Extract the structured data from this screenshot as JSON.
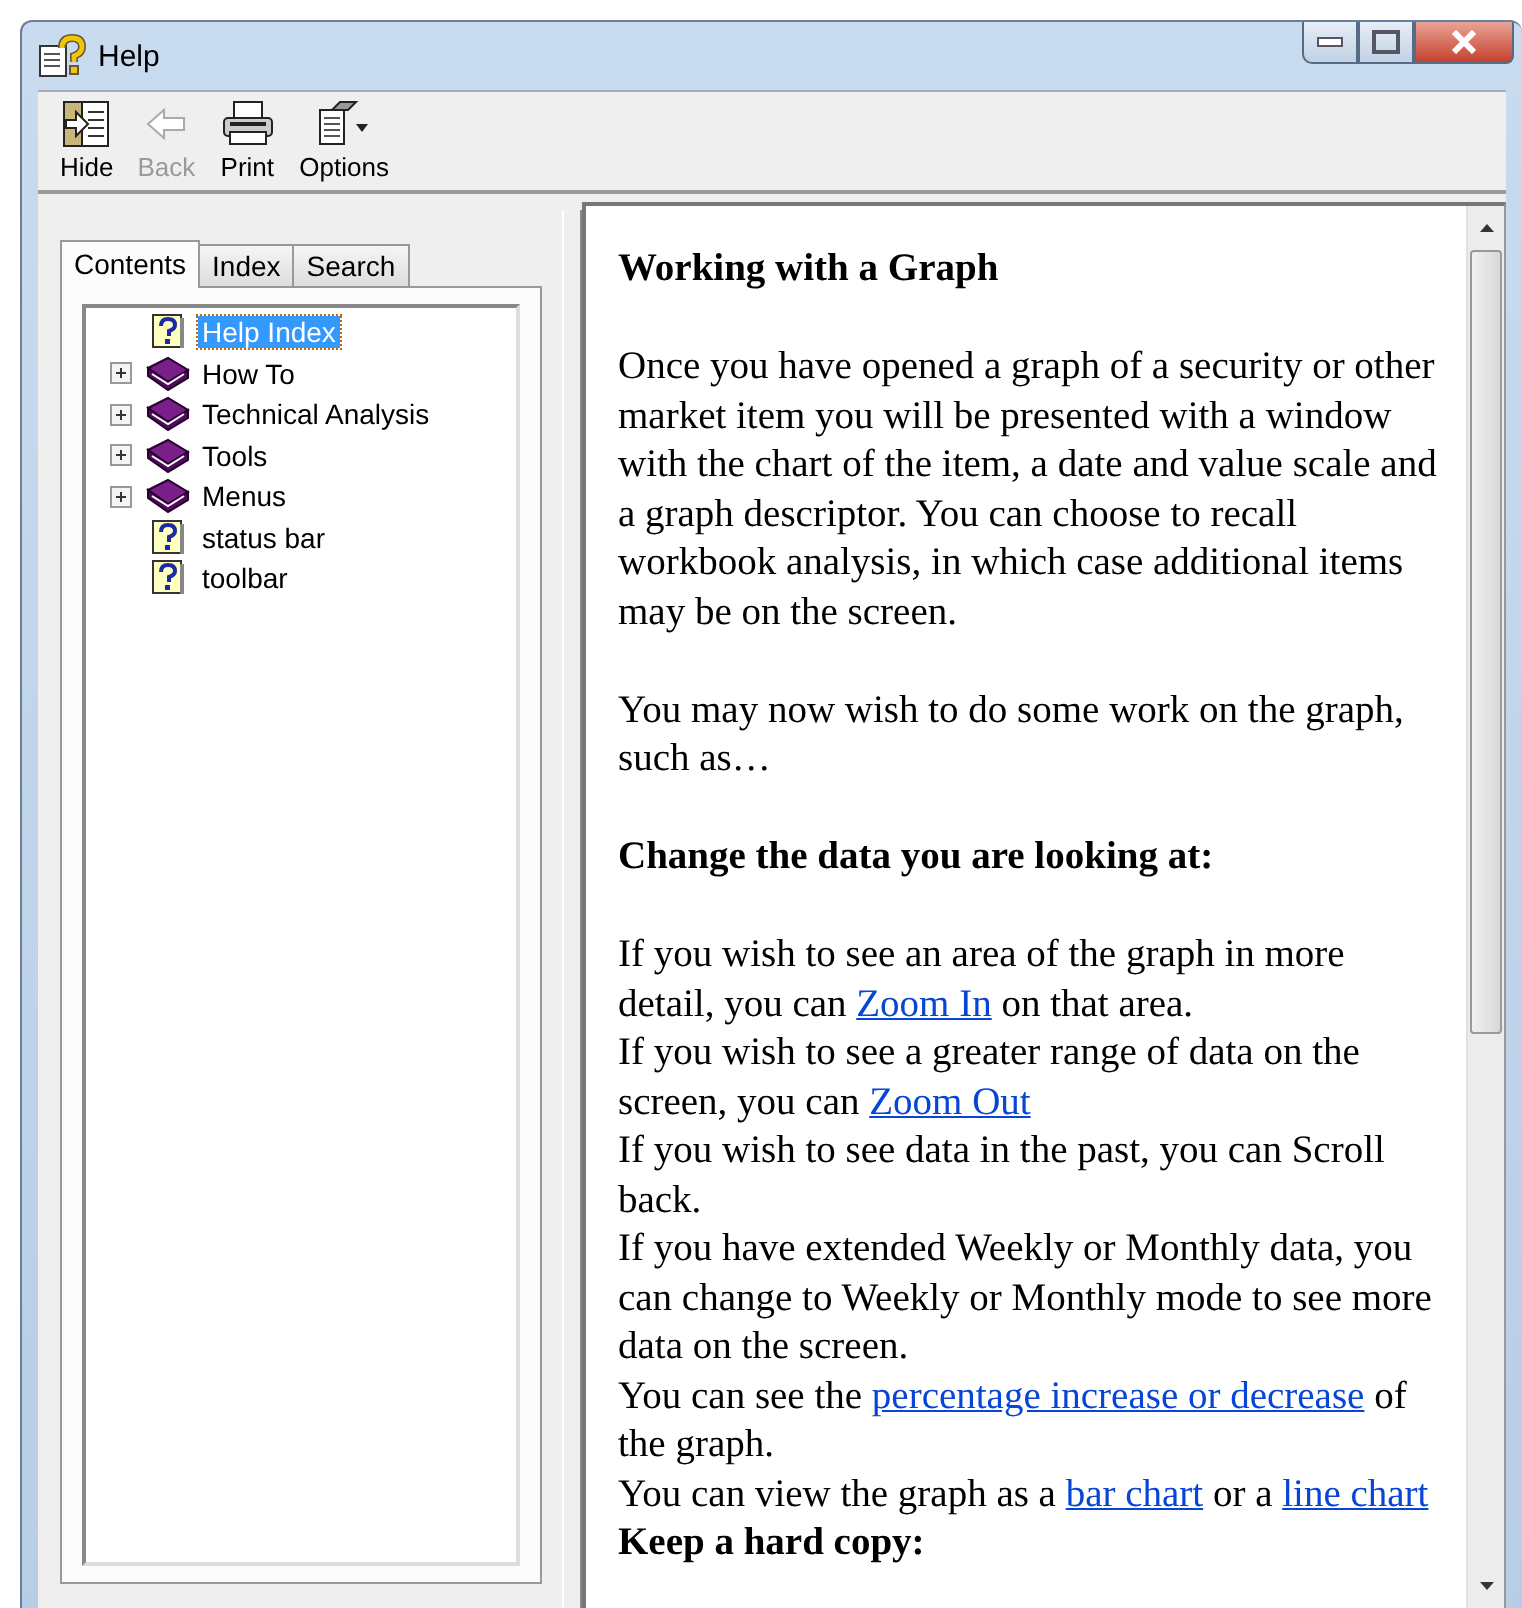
{
  "window": {
    "title": "Help"
  },
  "toolbar": [
    {
      "label": "Hide",
      "kind": "hide",
      "disabled": false
    },
    {
      "label": "Back",
      "kind": "back",
      "disabled": true
    },
    {
      "label": "Print",
      "kind": "print",
      "disabled": false
    },
    {
      "label": "Options",
      "kind": "options",
      "disabled": false
    }
  ],
  "tabs": [
    {
      "label": "Contents",
      "selected": true
    },
    {
      "label": "Index",
      "selected": false
    },
    {
      "label": "Search",
      "selected": false
    }
  ],
  "tree": [
    {
      "label": "Help Index",
      "kind": "topic",
      "selected": true
    },
    {
      "label": "How To",
      "kind": "book",
      "expanded": false,
      "selected": false
    },
    {
      "label": "Technical Analysis",
      "kind": "book",
      "expanded": false,
      "selected": false
    },
    {
      "label": "Tools",
      "kind": "book",
      "expanded": false,
      "selected": false
    },
    {
      "label": "Menus",
      "kind": "book",
      "expanded": false,
      "selected": false
    },
    {
      "label": "status bar",
      "kind": "topic",
      "selected": false
    },
    {
      "label": "toolbar",
      "kind": "topic",
      "selected": false
    }
  ],
  "article": [
    {
      "kind": "heading",
      "parts": [
        {
          "text": "Working with a Graph"
        }
      ]
    },
    {
      "kind": "paragraph",
      "parts": [
        {
          "text": "Once you have opened a graph of a security or other market item you will be presented with a window with the chart of the item, a date and value scale and a graph descriptor. You can choose to recall workbook analysis, in which case additional items may be on the screen."
        }
      ]
    },
    {
      "kind": "paragraph",
      "parts": [
        {
          "text": "You may now wish to do some work on the graph, such as…"
        }
      ]
    },
    {
      "kind": "heading",
      "parts": [
        {
          "text": "Change the data you are looking at:"
        }
      ]
    },
    {
      "kind": "line",
      "parts": [
        {
          "text": "If you wish to see an area of the graph in more detail, you can "
        },
        {
          "text": "Zoom In",
          "link": true
        },
        {
          "text": " on that area."
        }
      ]
    },
    {
      "kind": "line",
      "parts": [
        {
          "text": "If you wish to see a greater range of data on the screen, you can "
        },
        {
          "text": "Zoom Out",
          "link": true
        }
      ]
    },
    {
      "kind": "line",
      "parts": [
        {
          "text": "If you wish to see data in the past, you can Scroll back."
        }
      ]
    },
    {
      "kind": "line",
      "parts": [
        {
          "text": "If you have extended Weekly or Monthly data, you can change to Weekly or Monthly mode to see more data on the screen."
        }
      ]
    },
    {
      "kind": "line",
      "parts": [
        {
          "text": "You can see the "
        },
        {
          "text": "percentage increase or decrease",
          "link": true
        },
        {
          "text": " of the graph."
        }
      ]
    },
    {
      "kind": "line",
      "parts": [
        {
          "text": "You can view the graph as a "
        },
        {
          "text": "bar chart",
          "link": true
        },
        {
          "text": " or a "
        },
        {
          "text": "line chart",
          "link": true
        }
      ]
    },
    {
      "kind": "heading",
      "parts": [
        {
          "text": "Keep a hard copy:"
        }
      ]
    }
  ]
}
